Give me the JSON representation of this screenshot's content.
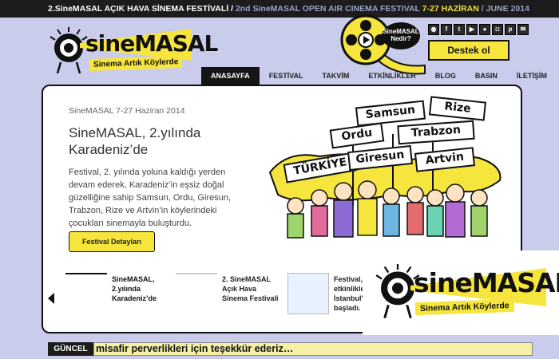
{
  "topbar": {
    "tr": "2.SineMASAL AÇIK HAVA SİNEMA FESTİVALİ",
    "sep1": "/",
    "en": "2nd SineMASAL OPEN AIR CINEMA FESTIVAL",
    "dates": "7-27 HAZİRAN",
    "sep2": "/",
    "june": "JUNE 2014"
  },
  "logo": {
    "text": "sineMASAL",
    "tagline": "Sinema Artık Köylerde"
  },
  "reel": {
    "bubble_line1": "SineMASAL",
    "bubble_line2": "Nedir?"
  },
  "social": {
    "icons": [
      "rss-icon",
      "facebook-icon",
      "twitter-icon",
      "youtube-icon",
      "flickr-icon",
      "instagram-icon",
      "pinterest-icon",
      "mail-icon"
    ]
  },
  "destek": {
    "label": "Destek ol"
  },
  "nav": {
    "items": [
      "ANASAYFA",
      "FESTİVAL",
      "TAKVİM",
      "ETKİNLİKLER",
      "BLOG",
      "BASIN",
      "İLETİŞİM"
    ],
    "active_index": 0
  },
  "hero": {
    "date": "SineMASAL 7-27 Haziran 2014",
    "title": "SineMASAL, 2.yılında Karadeniz’de",
    "description": "Festival, 2. yılında yoluna kaldığı yerden devam ederek, Karadeniz’in eşsiz doğal güzelliğine sahip Samsun, Ordu, Giresun, Trabzon, Rize ve Artvin’in köylerindeki çocukları sinemayla buluşturdu.",
    "button": "Festival Detayları"
  },
  "signs": [
    "Samsun",
    "Rize",
    "Ordu",
    "Trabzon",
    "TÜRKİYE",
    "Giresun",
    "Artvin"
  ],
  "thumbs": [
    {
      "line1": "SineMASAL,",
      "line2": "2.yılında",
      "line3": "Karadeniz’de"
    },
    {
      "line1": "2. SineMASAL",
      "line2": "Açık Hava",
      "line3": "Sinema Festivali"
    },
    {
      "line1": "Festival,",
      "line2": "etkinlikle",
      "line3": "İstanbul'",
      "line4": "başladı."
    }
  ],
  "popup": {
    "text": "sineMASAL",
    "tagline": "Sinema Artık Köylerde"
  },
  "ticker": {
    "label": "GÜNCEL",
    "text": "misafir perverlikleri için teşekkür ederiz…"
  },
  "colors": {
    "background": "#c9cceb",
    "accent_yellow": "#f5e53c",
    "dark": "#1c1c1c"
  }
}
